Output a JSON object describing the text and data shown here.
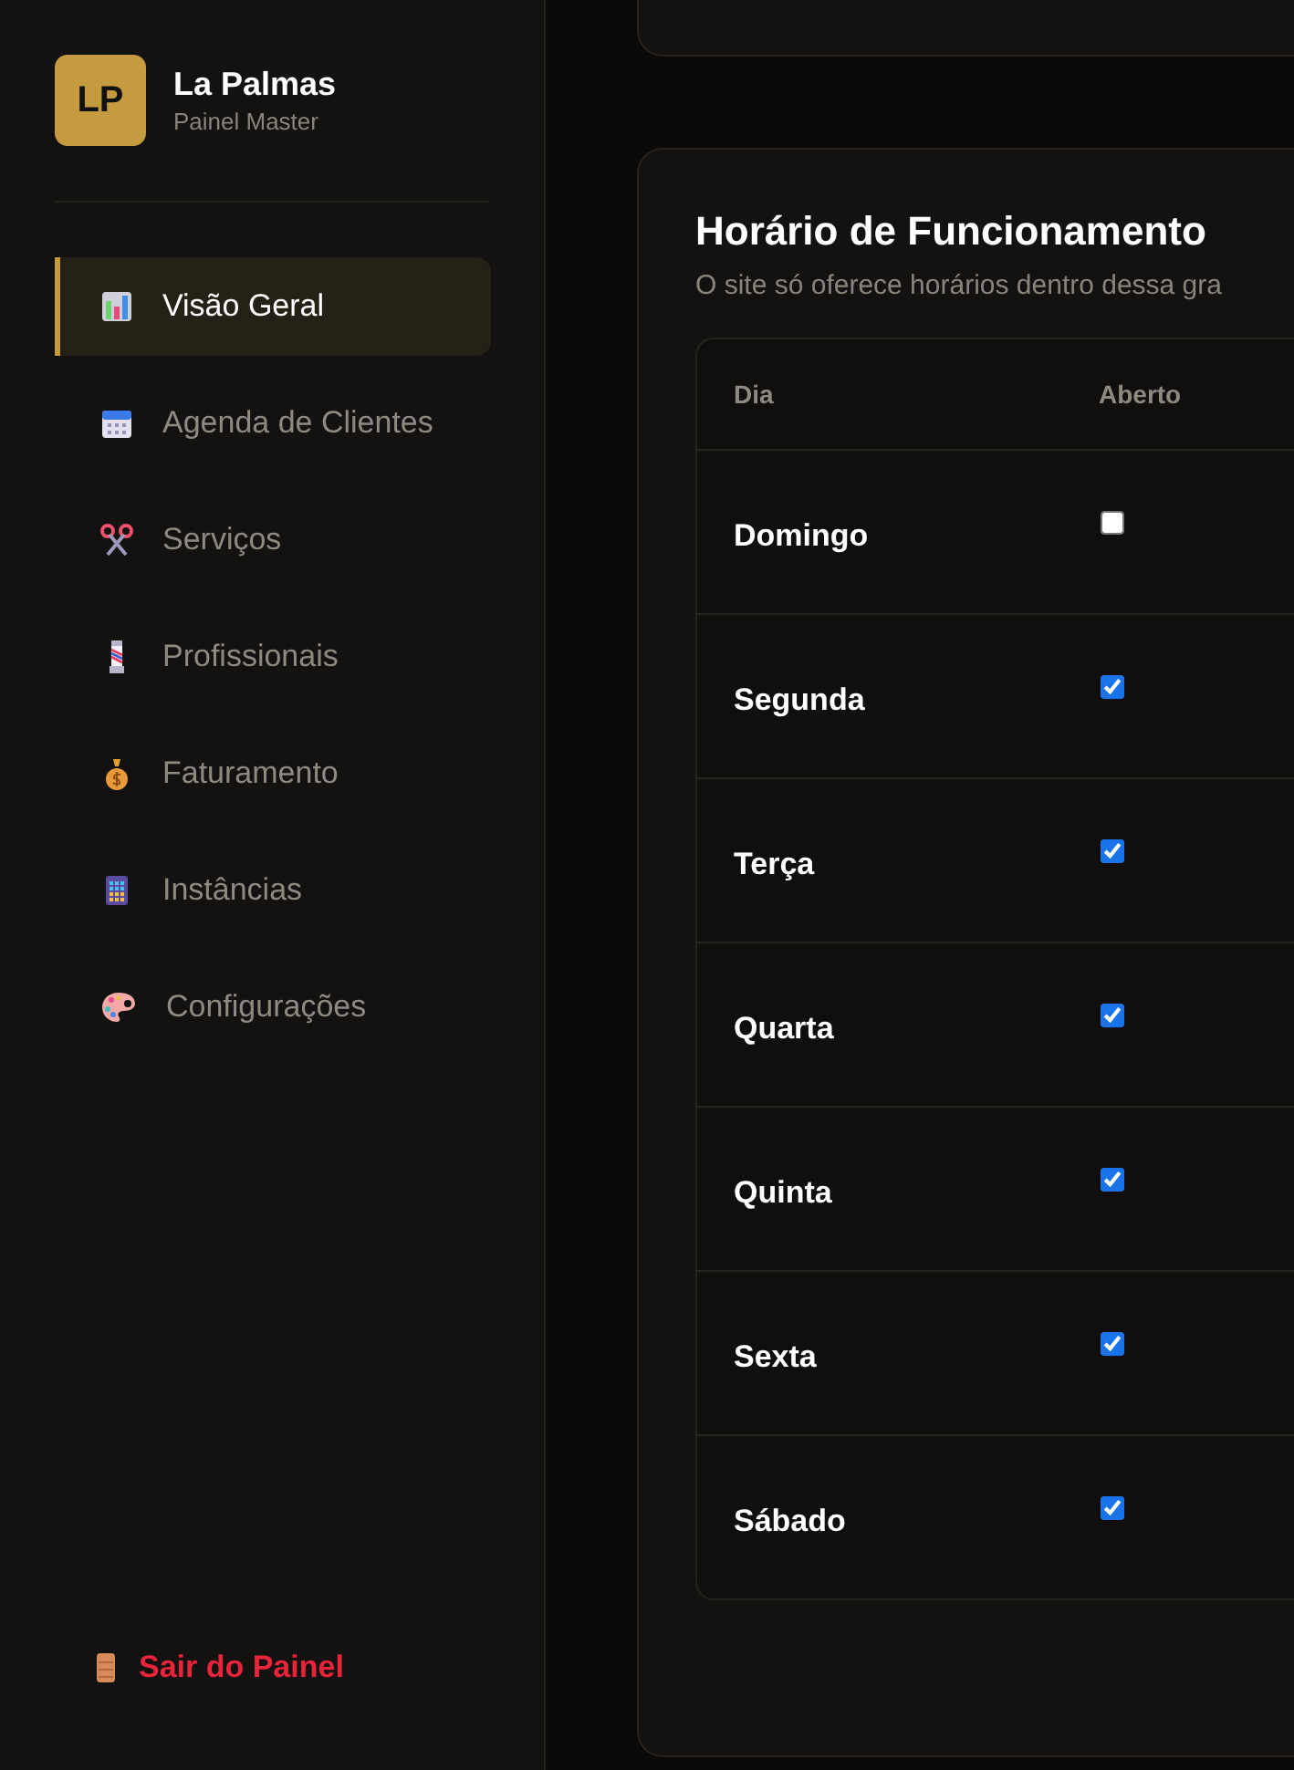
{
  "brand": {
    "logo": "LP",
    "name": "La Palmas",
    "subtitle": "Painel Master"
  },
  "nav": [
    {
      "label": "Visão Geral",
      "selected": true
    },
    {
      "label": "Agenda de Clientes",
      "selected": false
    },
    {
      "label": "Serviços",
      "selected": false
    },
    {
      "label": "Profissionais",
      "selected": false
    },
    {
      "label": "Faturamento",
      "selected": false
    },
    {
      "label": "Instâncias",
      "selected": false
    },
    {
      "label": "Configurações",
      "selected": false
    }
  ],
  "logout": "Sair do Painel",
  "hours": {
    "title": "Horário de Funcionamento",
    "subtitle": "O site só oferece horários dentro dessa gra",
    "columns": [
      "Dia",
      "Aberto"
    ],
    "rows": [
      {
        "day": "Domingo",
        "checked": false
      },
      {
        "day": "Segunda",
        "checked": true
      },
      {
        "day": "Terça",
        "checked": true
      },
      {
        "day": "Quarta",
        "checked": true
      },
      {
        "day": "Quinta",
        "checked": true
      },
      {
        "day": "Sexta",
        "checked": true
      },
      {
        "day": "Sábado",
        "checked": true
      }
    ]
  }
}
